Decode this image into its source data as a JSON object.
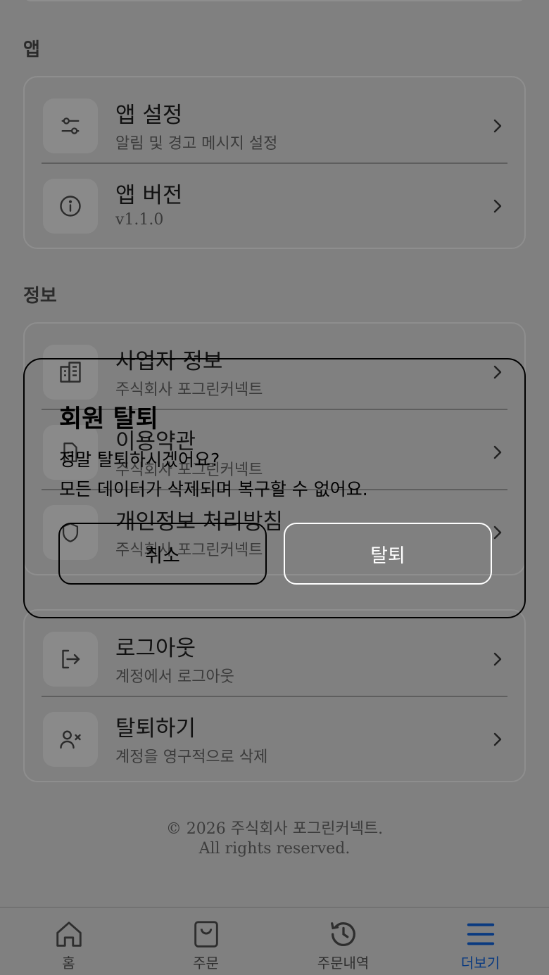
{
  "sections": {
    "app": {
      "title": "앱",
      "items": [
        {
          "title": "앱 설정",
          "subtitle": "알림 및 경고 메시지 설정",
          "icon": "sliders-icon"
        },
        {
          "title": "앱 버전",
          "subtitle": "v1.1.0",
          "icon": "info-icon"
        }
      ]
    },
    "info": {
      "title": "정보",
      "items": [
        {
          "title": "사업자 정보",
          "subtitle": "주식회사 포그린커넥트",
          "icon": "building-icon"
        },
        {
          "title": "이용약관",
          "subtitle": "주식회사 포그린커넥트",
          "icon": "document-icon"
        },
        {
          "title": "개인정보 처리방침",
          "subtitle": "주식회사 포그린커넥트",
          "icon": "shield-icon"
        }
      ]
    },
    "account": {
      "items": [
        {
          "title": "로그아웃",
          "subtitle": "계정에서 로그아웃",
          "icon": "logout-icon"
        },
        {
          "title": "탈퇴하기",
          "subtitle": "계정을 영구적으로 삭제",
          "icon": "user-remove-icon"
        }
      ]
    }
  },
  "footer": {
    "line1": "© 2026 주식회사 포그린커넥트.",
    "line2": "All rights reserved."
  },
  "modal": {
    "title": "회원 탈퇴",
    "message_line1": "정말 탈퇴하시겠어요?",
    "message_line2": "모든 데이터가 삭제되며 복구할 수 없어요.",
    "cancel_label": "취소",
    "confirm_label": "탈퇴"
  },
  "bottom_nav": {
    "items": [
      {
        "label": "홈",
        "icon": "home-icon"
      },
      {
        "label": "주문",
        "icon": "shopping-bag-icon"
      },
      {
        "label": "주문내역",
        "icon": "history-icon"
      },
      {
        "label": "더보기",
        "icon": "menu-icon",
        "active": true
      }
    ],
    "active_color": "#0a3a80"
  },
  "colors": {
    "overlay": "#808080",
    "border": "#8e8e8e"
  }
}
